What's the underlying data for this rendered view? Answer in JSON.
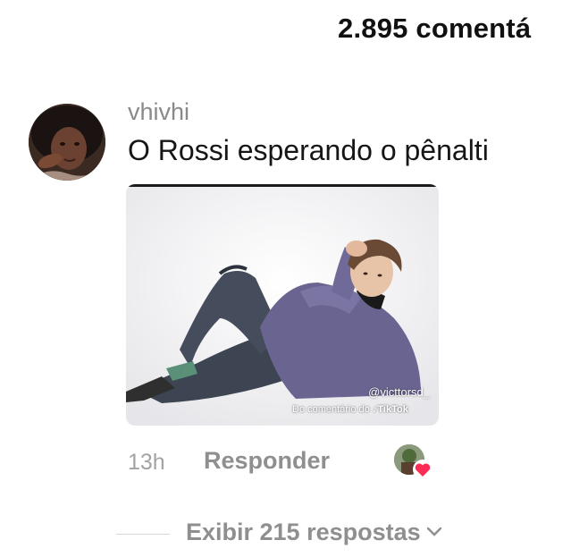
{
  "header": {
    "comment_count_label": "2.895 comentá"
  },
  "comment": {
    "username": "vhivhi",
    "text": "O Rossi esperando o pênalti",
    "sticker": {
      "watermark_handle": "@victtorsd_",
      "watermark_source_prefix": "Do comentário do",
      "watermark_brand": "TikTok"
    },
    "timestamp": "13h",
    "reply_label": "Responder"
  },
  "replies": {
    "view_label": "Exibir 215 respostas"
  },
  "colors": {
    "heart": "#fe2c55",
    "muted_text": "#8f8f8f",
    "primary_text": "#161616"
  }
}
